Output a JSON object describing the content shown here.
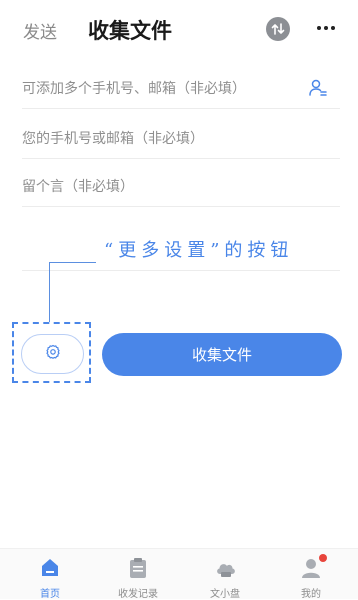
{
  "header": {
    "tab_send": "发送",
    "title": "收集文件"
  },
  "form": {
    "recipients_placeholder": "可添加多个手机号、邮箱（非必填）",
    "own_contact_placeholder": "您的手机号或邮箱（非必填）",
    "message_placeholder": "留个言（非必填）"
  },
  "annotation": {
    "text": "“更多设置”的按钮"
  },
  "actions": {
    "collect_label": "收集文件"
  },
  "bottom_nav": {
    "items": [
      {
        "label": "首页",
        "icon": "home-icon",
        "active": true
      },
      {
        "label": "收发记录",
        "icon": "records-icon",
        "active": false
      },
      {
        "label": "文小盘",
        "icon": "cloud-disk-icon",
        "active": false
      },
      {
        "label": "我的",
        "icon": "profile-icon",
        "active": false,
        "badge": true
      }
    ]
  },
  "colors": {
    "accent": "#4a86e8",
    "badge": "#e8453c"
  }
}
